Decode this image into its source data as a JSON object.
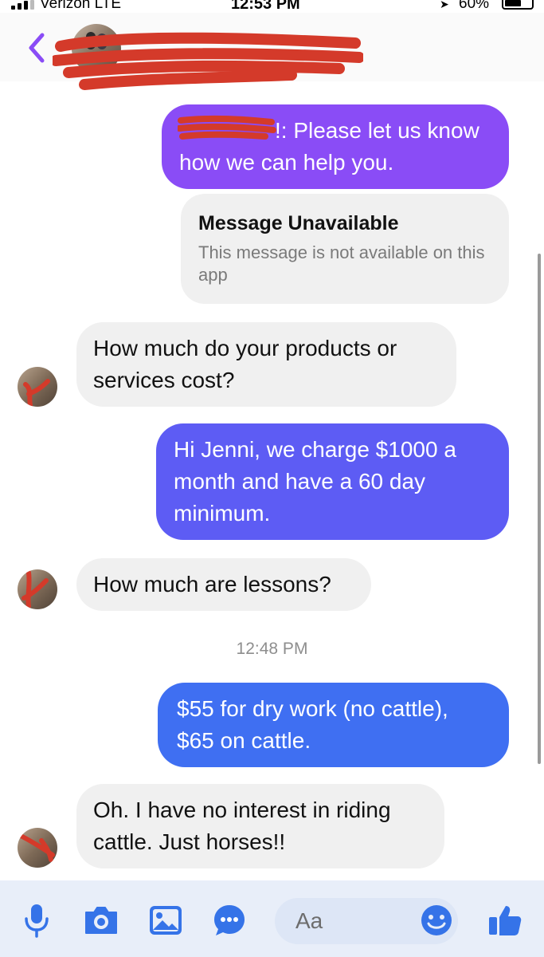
{
  "status_bar": {
    "carrier": "Verizon  LTE",
    "time": "12:53 PM",
    "battery": "60%"
  },
  "header": {
    "back_icon": "chevron-left-icon"
  },
  "messages": {
    "out1_visible": "!: Please let us know how we can help you.",
    "unavailable_title": "Message Unavailable",
    "unavailable_subtitle": "This message is not available on this app",
    "in1": "How much do your products or services cost?",
    "out2": "Hi Jenni, we charge $1000 a month and have a 60 day minimum.",
    "in2": "How much are lessons?",
    "timestamp": "12:48 PM",
    "out3": "$55 for dry work (no cattle), $65 on cattle.",
    "in3": "Oh. I have no interest in riding cattle. Just horses!!"
  },
  "composer": {
    "placeholder": "Aa",
    "icons": [
      "microphone-icon",
      "camera-icon",
      "gallery-icon",
      "more-dots-icon",
      "emoji-icon",
      "thumbs-up-icon"
    ]
  },
  "colors": {
    "accent_purple": "#8a4cf6",
    "accent_indigo": "#5d5cf4",
    "accent_blue": "#3f6ff2",
    "icon_blue": "#3573e8",
    "redaction_red": "#d43a2a"
  }
}
